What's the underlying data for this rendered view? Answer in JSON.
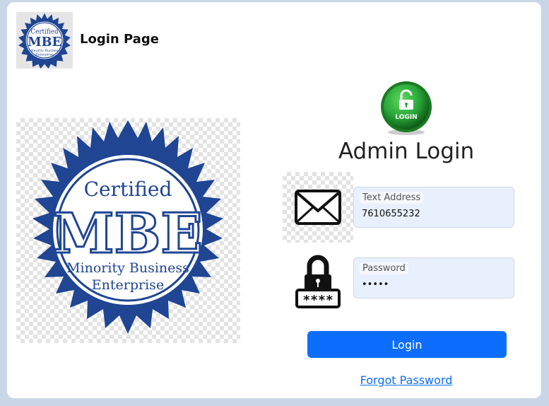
{
  "header": {
    "title": "Login Page",
    "logo_text": [
      "Certified",
      "MBE",
      "Minority Business",
      "Enterprise"
    ]
  },
  "hero_logo": {
    "line1": "Certified",
    "line2": "MBE",
    "line3": "Minority Business",
    "line4": "Enterprise"
  },
  "login_badge": {
    "label": "LOGIN"
  },
  "form": {
    "title": "Admin Login",
    "text_field": {
      "label": "Text Address",
      "value": "7610655232"
    },
    "password_field": {
      "label": "Password",
      "value": "•••••"
    },
    "submit_label": "Login",
    "forgot_label": "Forgot Password"
  },
  "icons": [
    "envelope-icon",
    "password-lock-icon",
    "login-lock-icon",
    "mbe-seal-logo"
  ],
  "colors": {
    "background": "#c9d6e6",
    "seal_blue": "#1f4593",
    "primary": "#0d6efd",
    "field_bg": "#e8f0fe",
    "badge_green": "#2aa63a"
  }
}
